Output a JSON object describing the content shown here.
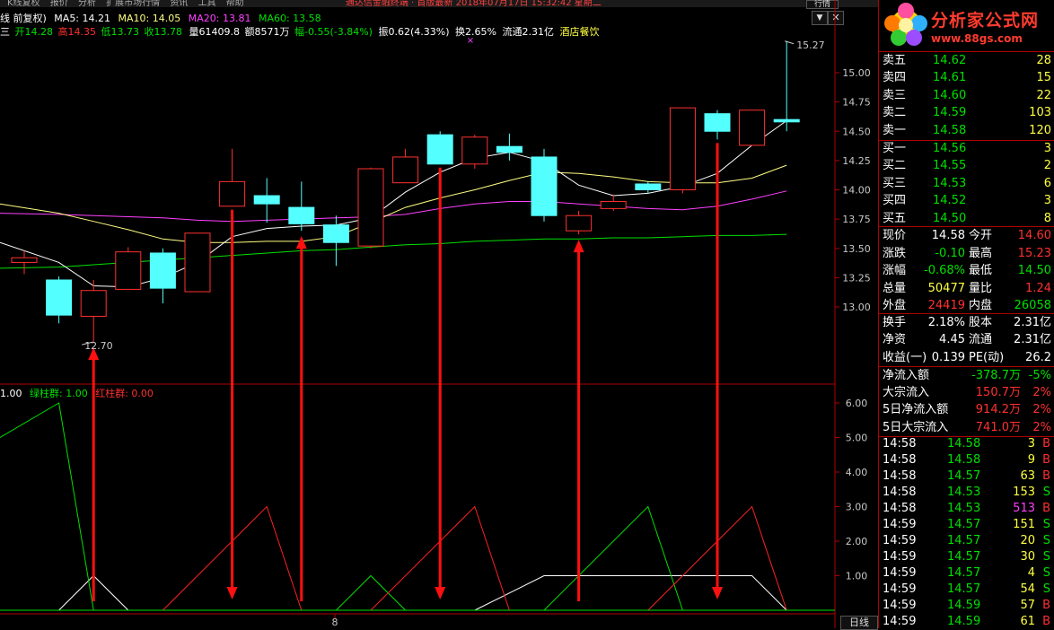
{
  "topbar": {
    "menu": [
      "K线复权",
      "报价",
      "分析",
      "扩展市场行情",
      "资讯",
      "工具",
      "帮助"
    ],
    "center_text": "通达信金融终端 · 首版最新 2018年07月17日 15:32:42 星期二",
    "right_button": "行情"
  },
  "header": {
    "row1": {
      "prefix": "线 前复权)",
      "ma5": "MA5: 14.21",
      "ma10": "MA10: 14.05",
      "ma20": "MA20: 13.81",
      "ma60": "MA60: 13.58"
    },
    "row2": {
      "prefix": "三",
      "open": "开14.28",
      "high": "高14.35",
      "low": "低13.73",
      "close": "收13.78",
      "volume": "量61409.8",
      "amount": "额8571万",
      "change": "幅-0.55(-3.84%)",
      "amplitude": "振0.62(4.33%)",
      "turnover": "换2.65%",
      "float": "流通2.31亿",
      "sector": "酒店餐饮"
    }
  },
  "price_axis": {
    "ticks": [
      "15.00",
      "14.75",
      "14.50",
      "14.25",
      "14.00",
      "13.75",
      "13.50",
      "13.25",
      "13.00"
    ],
    "high_label": "15.27",
    "low_label": "12.70"
  },
  "indicator": {
    "label_prefix": "1.00",
    "green_label": "绿柱群: 1.00",
    "red_label": "红柱群: 0.00",
    "ticks": [
      "6.00",
      "5.00",
      "4.00",
      "3.00",
      "2.00",
      "1.00"
    ]
  },
  "bottom": {
    "date_label": "8",
    "period_button": "日线"
  },
  "chart_data": {
    "type": "candlestick",
    "candles": [
      {
        "o": 13.38,
        "h": 13.48,
        "l": 13.28,
        "c": 13.42
      },
      {
        "o": 13.23,
        "h": 13.26,
        "l": 12.86,
        "c": 12.93
      },
      {
        "o": 12.92,
        "h": 13.23,
        "l": 12.7,
        "c": 13.14
      },
      {
        "o": 13.15,
        "h": 13.51,
        "l": 13.15,
        "c": 13.47
      },
      {
        "o": 13.46,
        "h": 13.5,
        "l": 13.03,
        "c": 13.16
      },
      {
        "o": 13.13,
        "h": 13.63,
        "l": 13.13,
        "c": 13.63
      },
      {
        "o": 13.86,
        "h": 14.35,
        "l": 13.86,
        "c": 14.07
      },
      {
        "o": 13.95,
        "h": 14.1,
        "l": 13.72,
        "c": 13.88
      },
      {
        "o": 13.85,
        "h": 14.07,
        "l": 13.65,
        "c": 13.71
      },
      {
        "o": 13.7,
        "h": 13.78,
        "l": 13.35,
        "c": 13.55
      },
      {
        "o": 13.52,
        "h": 14.19,
        "l": 13.5,
        "c": 14.18
      },
      {
        "o": 14.06,
        "h": 14.35,
        "l": 14.08,
        "c": 14.28
      },
      {
        "o": 14.47,
        "h": 14.5,
        "l": 14.22,
        "c": 14.22
      },
      {
        "o": 14.22,
        "h": 14.47,
        "l": 14.18,
        "c": 14.45
      },
      {
        "o": 14.37,
        "h": 14.48,
        "l": 14.25,
        "c": 14.32
      },
      {
        "o": 14.28,
        "h": 14.35,
        "l": 13.73,
        "c": 13.78
      },
      {
        "o": 13.65,
        "h": 13.82,
        "l": 13.62,
        "c": 13.78
      },
      {
        "o": 13.84,
        "h": 13.96,
        "l": 13.82,
        "c": 13.9
      },
      {
        "o": 14.05,
        "h": 14.07,
        "l": 13.97,
        "c": 14.0
      },
      {
        "o": 14.0,
        "h": 14.7,
        "l": 13.97,
        "c": 14.7
      },
      {
        "o": 14.65,
        "h": 14.68,
        "l": 14.43,
        "c": 14.5
      },
      {
        "o": 14.38,
        "h": 14.68,
        "l": 14.38,
        "c": 14.68
      },
      {
        "o": 14.6,
        "h": 15.27,
        "l": 14.5,
        "c": 14.58
      }
    ],
    "ma5": [
      13.55,
      13.38,
      13.18,
      13.17,
      13.25,
      13.38,
      13.6,
      13.67,
      13.69,
      13.7,
      13.76,
      13.98,
      14.15,
      14.27,
      14.32,
      14.24,
      14.04,
      13.95,
      13.97,
      14.03,
      14.14,
      14.38,
      14.59
    ],
    "ma10": [
      13.88,
      13.8,
      13.73,
      13.66,
      13.58,
      13.55,
      13.55,
      13.56,
      13.56,
      13.6,
      13.72,
      13.85,
      13.93,
      14.0,
      14.08,
      14.15,
      14.14,
      14.11,
      14.07,
      14.06,
      14.06,
      14.1,
      14.21
    ],
    "ma20": [
      13.8,
      13.79,
      13.78,
      13.77,
      13.76,
      13.74,
      13.73,
      13.74,
      13.75,
      13.76,
      13.77,
      13.79,
      13.84,
      13.88,
      13.9,
      13.9,
      13.88,
      13.86,
      13.84,
      13.83,
      13.86,
      13.92,
      13.99
    ],
    "ma60": [
      13.33,
      13.34,
      13.36,
      13.38,
      13.4,
      13.42,
      13.44,
      13.46,
      13.48,
      13.49,
      13.51,
      13.53,
      13.54,
      13.56,
      13.57,
      13.58,
      13.58,
      13.59,
      13.59,
      13.6,
      13.61,
      13.61,
      13.62
    ],
    "ylim": [
      12.7,
      15.27
    ],
    "indicator_red": [
      null,
      null,
      null,
      null,
      0,
      1,
      2,
      3,
      0,
      null,
      0,
      1,
      2,
      3,
      0,
      null,
      null,
      null,
      0,
      1,
      2,
      3,
      0
    ],
    "indicator_green": [
      5,
      6,
      0,
      null,
      null,
      null,
      null,
      null,
      null,
      0,
      1,
      0,
      null,
      null,
      null,
      0,
      1,
      2,
      3,
      0,
      null,
      null,
      null
    ],
    "indicator_white": [
      0,
      0,
      1,
      0,
      null,
      null,
      null,
      null,
      null,
      null,
      null,
      null,
      null,
      0,
      0.5,
      1,
      1,
      1,
      1,
      1,
      1,
      1,
      0
    ],
    "arrows": [
      {
        "i": 2,
        "dir": "up"
      },
      {
        "i": 6,
        "dir": "down"
      },
      {
        "i": 8,
        "dir": "up"
      },
      {
        "i": 12,
        "dir": "down"
      },
      {
        "i": 16,
        "dir": "up"
      },
      {
        "i": 20,
        "dir": "down"
      }
    ]
  },
  "quotes": {
    "asks": [
      {
        "label": "卖五",
        "price": "14.62",
        "vol": "28"
      },
      {
        "label": "卖四",
        "price": "14.61",
        "vol": "15"
      },
      {
        "label": "卖三",
        "price": "14.60",
        "vol": "22"
      },
      {
        "label": "卖二",
        "price": "14.59",
        "vol": "103"
      },
      {
        "label": "卖一",
        "price": "14.58",
        "vol": "120"
      }
    ],
    "bids": [
      {
        "label": "买一",
        "price": "14.56",
        "vol": "3"
      },
      {
        "label": "买二",
        "price": "14.55",
        "vol": "2"
      },
      {
        "label": "买三",
        "price": "14.53",
        "vol": "6"
      },
      {
        "label": "买四",
        "price": "14.52",
        "vol": "3"
      },
      {
        "label": "买五",
        "price": "14.50",
        "vol": "8"
      }
    ],
    "stats": [
      {
        "l1": "现价",
        "v1": "14.58",
        "c1": "#ffffff",
        "l2": "今开",
        "v2": "14.60",
        "c2": "#ff3030"
      },
      {
        "l1": "涨跌",
        "v1": "-0.10",
        "c1": "#00e000",
        "l2": "最高",
        "v2": "15.23",
        "c2": "#ff3030"
      },
      {
        "l1": "涨幅",
        "v1": "-0.68%",
        "c1": "#00e000",
        "l2": "最低",
        "v2": "14.50",
        "c2": "#00e000"
      },
      {
        "l1": "总量",
        "v1": "50477",
        "c1": "#ffff40",
        "l2": "量比",
        "v2": "1.24",
        "c2": "#ff3030"
      },
      {
        "l1": "外盘",
        "v1": "24419",
        "c1": "#ff3030",
        "l2": "内盘",
        "v2": "26058",
        "c2": "#00e000"
      }
    ],
    "fundamentals": [
      {
        "l1": "换手",
        "v1": "2.18%",
        "l2": "股本",
        "v2": "2.31亿"
      },
      {
        "l1": "净资",
        "v1": "4.45",
        "l2": "流通",
        "v2": "2.31亿"
      },
      {
        "l1": "收益(一)",
        "v1": "0.139",
        "l2": "PE(动)",
        "v2": "26.2"
      }
    ],
    "flows": [
      {
        "label": "净流入额",
        "value": "-378.7万",
        "pct": "-5%",
        "color": "#00e000"
      },
      {
        "label": "大宗流入",
        "value": "150.7万",
        "pct": "2%",
        "color": "#ff3030"
      },
      {
        "label": "5日净流入额",
        "value": "914.2万",
        "pct": "2%",
        "color": "#ff3030"
      },
      {
        "label": "5日大宗流入",
        "value": "741.0万",
        "pct": "2%",
        "color": "#ff3030"
      }
    ],
    "ticks": [
      {
        "time": "14:58",
        "price": "14.58",
        "vol": "3",
        "side": "B",
        "vcolor": "#ffff40"
      },
      {
        "time": "14:58",
        "price": "14.58",
        "vol": "9",
        "side": "B",
        "vcolor": "#ffff40"
      },
      {
        "time": "14:58",
        "price": "14.57",
        "vol": "63",
        "side": "B",
        "vcolor": "#ffff40"
      },
      {
        "time": "14:58",
        "price": "14.53",
        "vol": "153",
        "side": "S",
        "vcolor": "#ffff40"
      },
      {
        "time": "14:58",
        "price": "14.53",
        "vol": "513",
        "side": "B",
        "vcolor": "#ff40ff"
      },
      {
        "time": "14:59",
        "price": "14.57",
        "vol": "151",
        "side": "S",
        "vcolor": "#ffff40"
      },
      {
        "time": "14:59",
        "price": "14.57",
        "vol": "20",
        "side": "S",
        "vcolor": "#ffff40"
      },
      {
        "time": "14:59",
        "price": "14.57",
        "vol": "30",
        "side": "S",
        "vcolor": "#ffff40"
      },
      {
        "time": "14:59",
        "price": "14.57",
        "vol": "4",
        "side": "S",
        "vcolor": "#ffff40"
      },
      {
        "time": "14:59",
        "price": "14.57",
        "vol": "54",
        "side": "S",
        "vcolor": "#ffff40"
      },
      {
        "time": "14:59",
        "price": "14.59",
        "vol": "57",
        "side": "B",
        "vcolor": "#ffff40"
      },
      {
        "time": "14:59",
        "price": "14.59",
        "vol": "61",
        "side": "B",
        "vcolor": "#ffff40"
      }
    ]
  },
  "logo": {
    "title": "分析家公式网",
    "url": "www.88gs.com"
  },
  "colors": {
    "up": "#ff3030",
    "down": "#54ffff",
    "ma5": "#ffffff",
    "ma10": "#ffff80",
    "ma20": "#ff40ff",
    "ma60": "#00e000",
    "grid": "#b00000"
  }
}
